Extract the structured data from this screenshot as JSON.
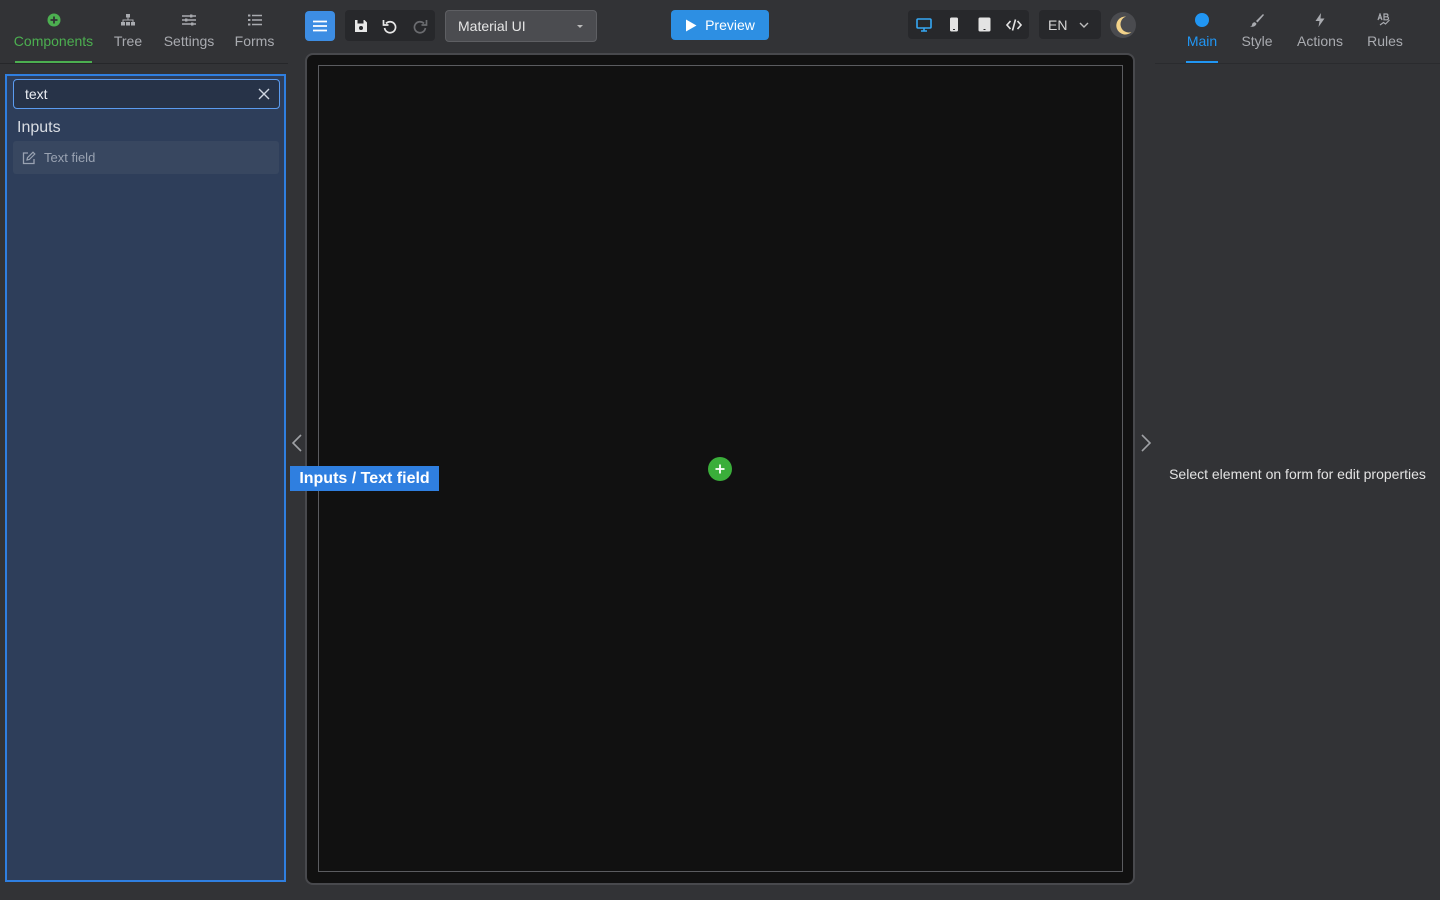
{
  "left_tabs": [
    {
      "label": "Components",
      "icon": "plus-circle-icon"
    },
    {
      "label": "Tree",
      "icon": "tree-icon"
    },
    {
      "label": "Settings",
      "icon": "sliders-icon"
    },
    {
      "label": "Forms",
      "icon": "list-icon"
    }
  ],
  "search": {
    "value": "text"
  },
  "components": {
    "group_title": "Inputs",
    "items": [
      {
        "label": "Text field",
        "icon": "edit-icon"
      }
    ]
  },
  "toolbar": {
    "theme_select": "Material UI",
    "preview_label": "Preview",
    "language": "EN"
  },
  "drag_label": "Inputs / Text field",
  "right_tabs": [
    {
      "label": "Main",
      "icon": "dot-icon"
    },
    {
      "label": "Style",
      "icon": "brush-icon"
    },
    {
      "label": "Actions",
      "icon": "lightning-icon"
    },
    {
      "label": "Rules",
      "icon": "ab-icon"
    }
  ],
  "properties_hint": "Select element on form for edit properties",
  "colors": {
    "accent_green": "#4caf50",
    "accent_blue": "#2196f3",
    "selection_blue": "#2f7fe0"
  }
}
